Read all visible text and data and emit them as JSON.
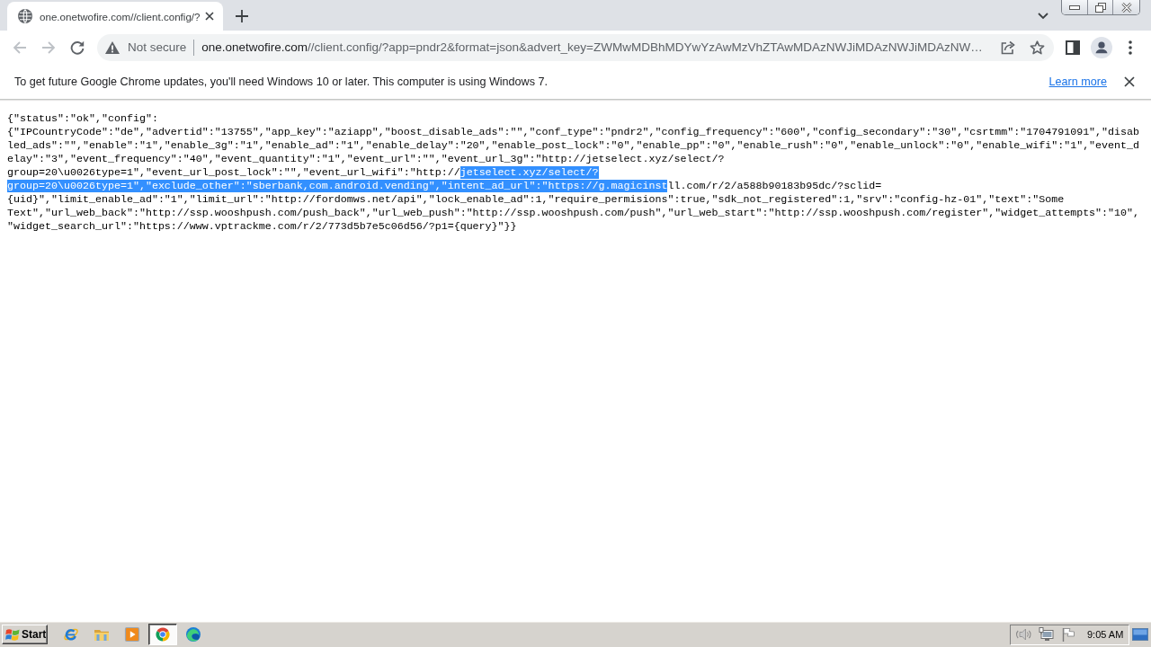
{
  "tab_strip": {
    "tabs": [
      {
        "title": "one.onetwofire.com//client.config/?",
        "selected": true
      }
    ]
  },
  "toolbar": {
    "nav_buttons": [
      {
        "kind": "back",
        "disabled": true
      },
      {
        "kind": "forward",
        "disabled": true
      },
      {
        "kind": "reload",
        "disabled": false
      }
    ],
    "address_bar": {
      "security_label": "Not secure",
      "host": "one.onetwofire.com",
      "path": "//client.config/?app=pndr2&format=json&advert_key=ZWMwMDBhMDYwYzAwMzVhZTAwMDAzNWJiMDAzNWJiMDAzNW…"
    }
  },
  "infobar": {
    "message": "To get future Google Chrome updates, you'll need Windows 10 or later. This computer is using Windows 7.",
    "link": "Learn more"
  },
  "document": {
    "lines": [
      {
        "segments": [
          {
            "text": "{\"status\":\"ok\",\"config\":",
            "selected": false
          }
        ]
      },
      {
        "segments": [
          {
            "text": "{\"IPCountryCode\":\"de\",\"advertid\":\"13755\",\"app_key\":\"aziapp\",\"boost_disable_ads\":\"\",\"conf_type\":\"pndr2\",\"config_frequency\":\"600\",\"config_secondary\":\"30\",\"csrtmm\":\"1704791091\",\"disab",
            "selected": false
          }
        ]
      },
      {
        "segments": [
          {
            "text": "led_ads\":\"\",\"enable\":\"1\",\"enable_3g\":\"1\",\"enable_ad\":\"1\",\"enable_delay\":\"20\",\"enable_post_lock\":\"0\",\"enable_pp\":\"0\",\"enable_rush\":\"0\",\"enable_unlock\":\"0\",\"enable_wifi\":\"1\",\"event_d",
            "selected": false
          }
        ]
      },
      {
        "segments": [
          {
            "text": "elay\":\"3\",\"event_frequency\":\"40\",\"event_quantity\":\"1\",\"event_url\":\"\",\"event_url_3g\":\"http://jetselect.xyz/select/?",
            "selected": false
          }
        ]
      },
      {
        "segments": [
          {
            "text": "group=20\\u0026type=1\",\"event_url_post_lock\":\"\",\"event_url_wifi\":\"http://",
            "selected": false
          },
          {
            "text": "jetselect.xyz/select/?",
            "selected": true
          }
        ]
      },
      {
        "segments": [
          {
            "text": "group=20\\u0026type=1\",\"exclude_other\":\"sberbank,com.android.vending\",\"intent_ad_url\":\"https://g.magicinst",
            "selected": true
          },
          {
            "text": "ll.com/r/2/a588b90183b95dc/?sclid=",
            "selected": false
          }
        ]
      },
      {
        "segments": [
          {
            "text": "{uid}\",\"limit_enable_ad\":\"1\",\"limit_url\":\"http://fordomws.net/api\",\"lock_enable_ad\":1,\"require_permisions\":true,\"sdk_not_registered\":1,\"srv\":\"config-hz-01\",\"text\":\"Some",
            "selected": false
          }
        ]
      },
      {
        "segments": [
          {
            "text": "Text\",\"url_web_back\":\"http://ssp.wooshpush.com/push_back\",\"url_web_push\":\"http://ssp.wooshpush.com/push\",\"url_web_start\":\"http://ssp.wooshpush.com/register\",\"widget_attempts\":\"10\",",
            "selected": false
          }
        ]
      },
      {
        "segments": [
          {
            "text": "\"widget_search_url\":\"https://www.vptrackme.com/r/2/773d5b7e5c06d56/?p1={query}\"}}",
            "selected": false
          }
        ]
      }
    ]
  },
  "taskbar": {
    "start_label": "Start",
    "apps": [
      {
        "kind": "ie",
        "selected": false
      },
      {
        "kind": "folder",
        "selected": false
      },
      {
        "kind": "media",
        "selected": false
      },
      {
        "kind": "chrome",
        "selected": true
      },
      {
        "kind": "edge",
        "selected": false
      }
    ],
    "clock": "9:05 AM"
  }
}
